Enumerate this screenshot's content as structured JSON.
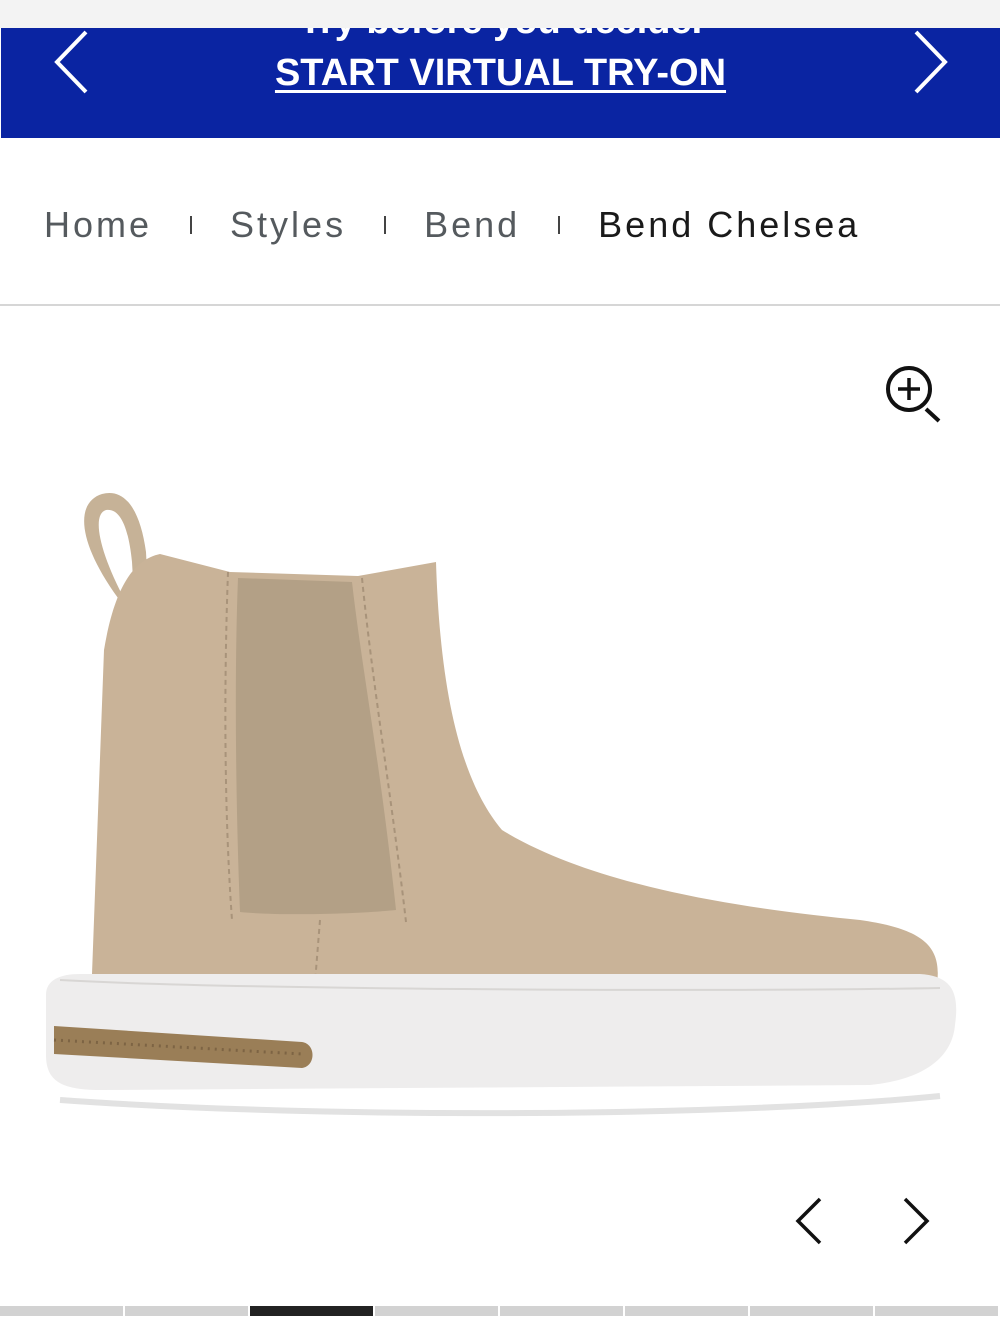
{
  "banner": {
    "subtitle": "Try before you decide.",
    "cta": "START VIRTUAL TRY-ON"
  },
  "breadcrumb": {
    "items": [
      "Home",
      "Styles",
      "Bend",
      "Bend Chelsea"
    ]
  },
  "icons": {
    "banner_prev": "chevron-left-icon",
    "banner_next": "chevron-right-icon",
    "zoom": "zoom-in-icon",
    "carousel_prev": "chevron-left-icon",
    "carousel_next": "chevron-right-icon"
  },
  "gallery": {
    "slide_count": 8,
    "active_slide": 3
  },
  "colors": {
    "banner_bg": "#0a24a2",
    "banner_text": "#ffffff",
    "progress_active": "#222222",
    "progress_inactive": "#d2d2d2"
  }
}
